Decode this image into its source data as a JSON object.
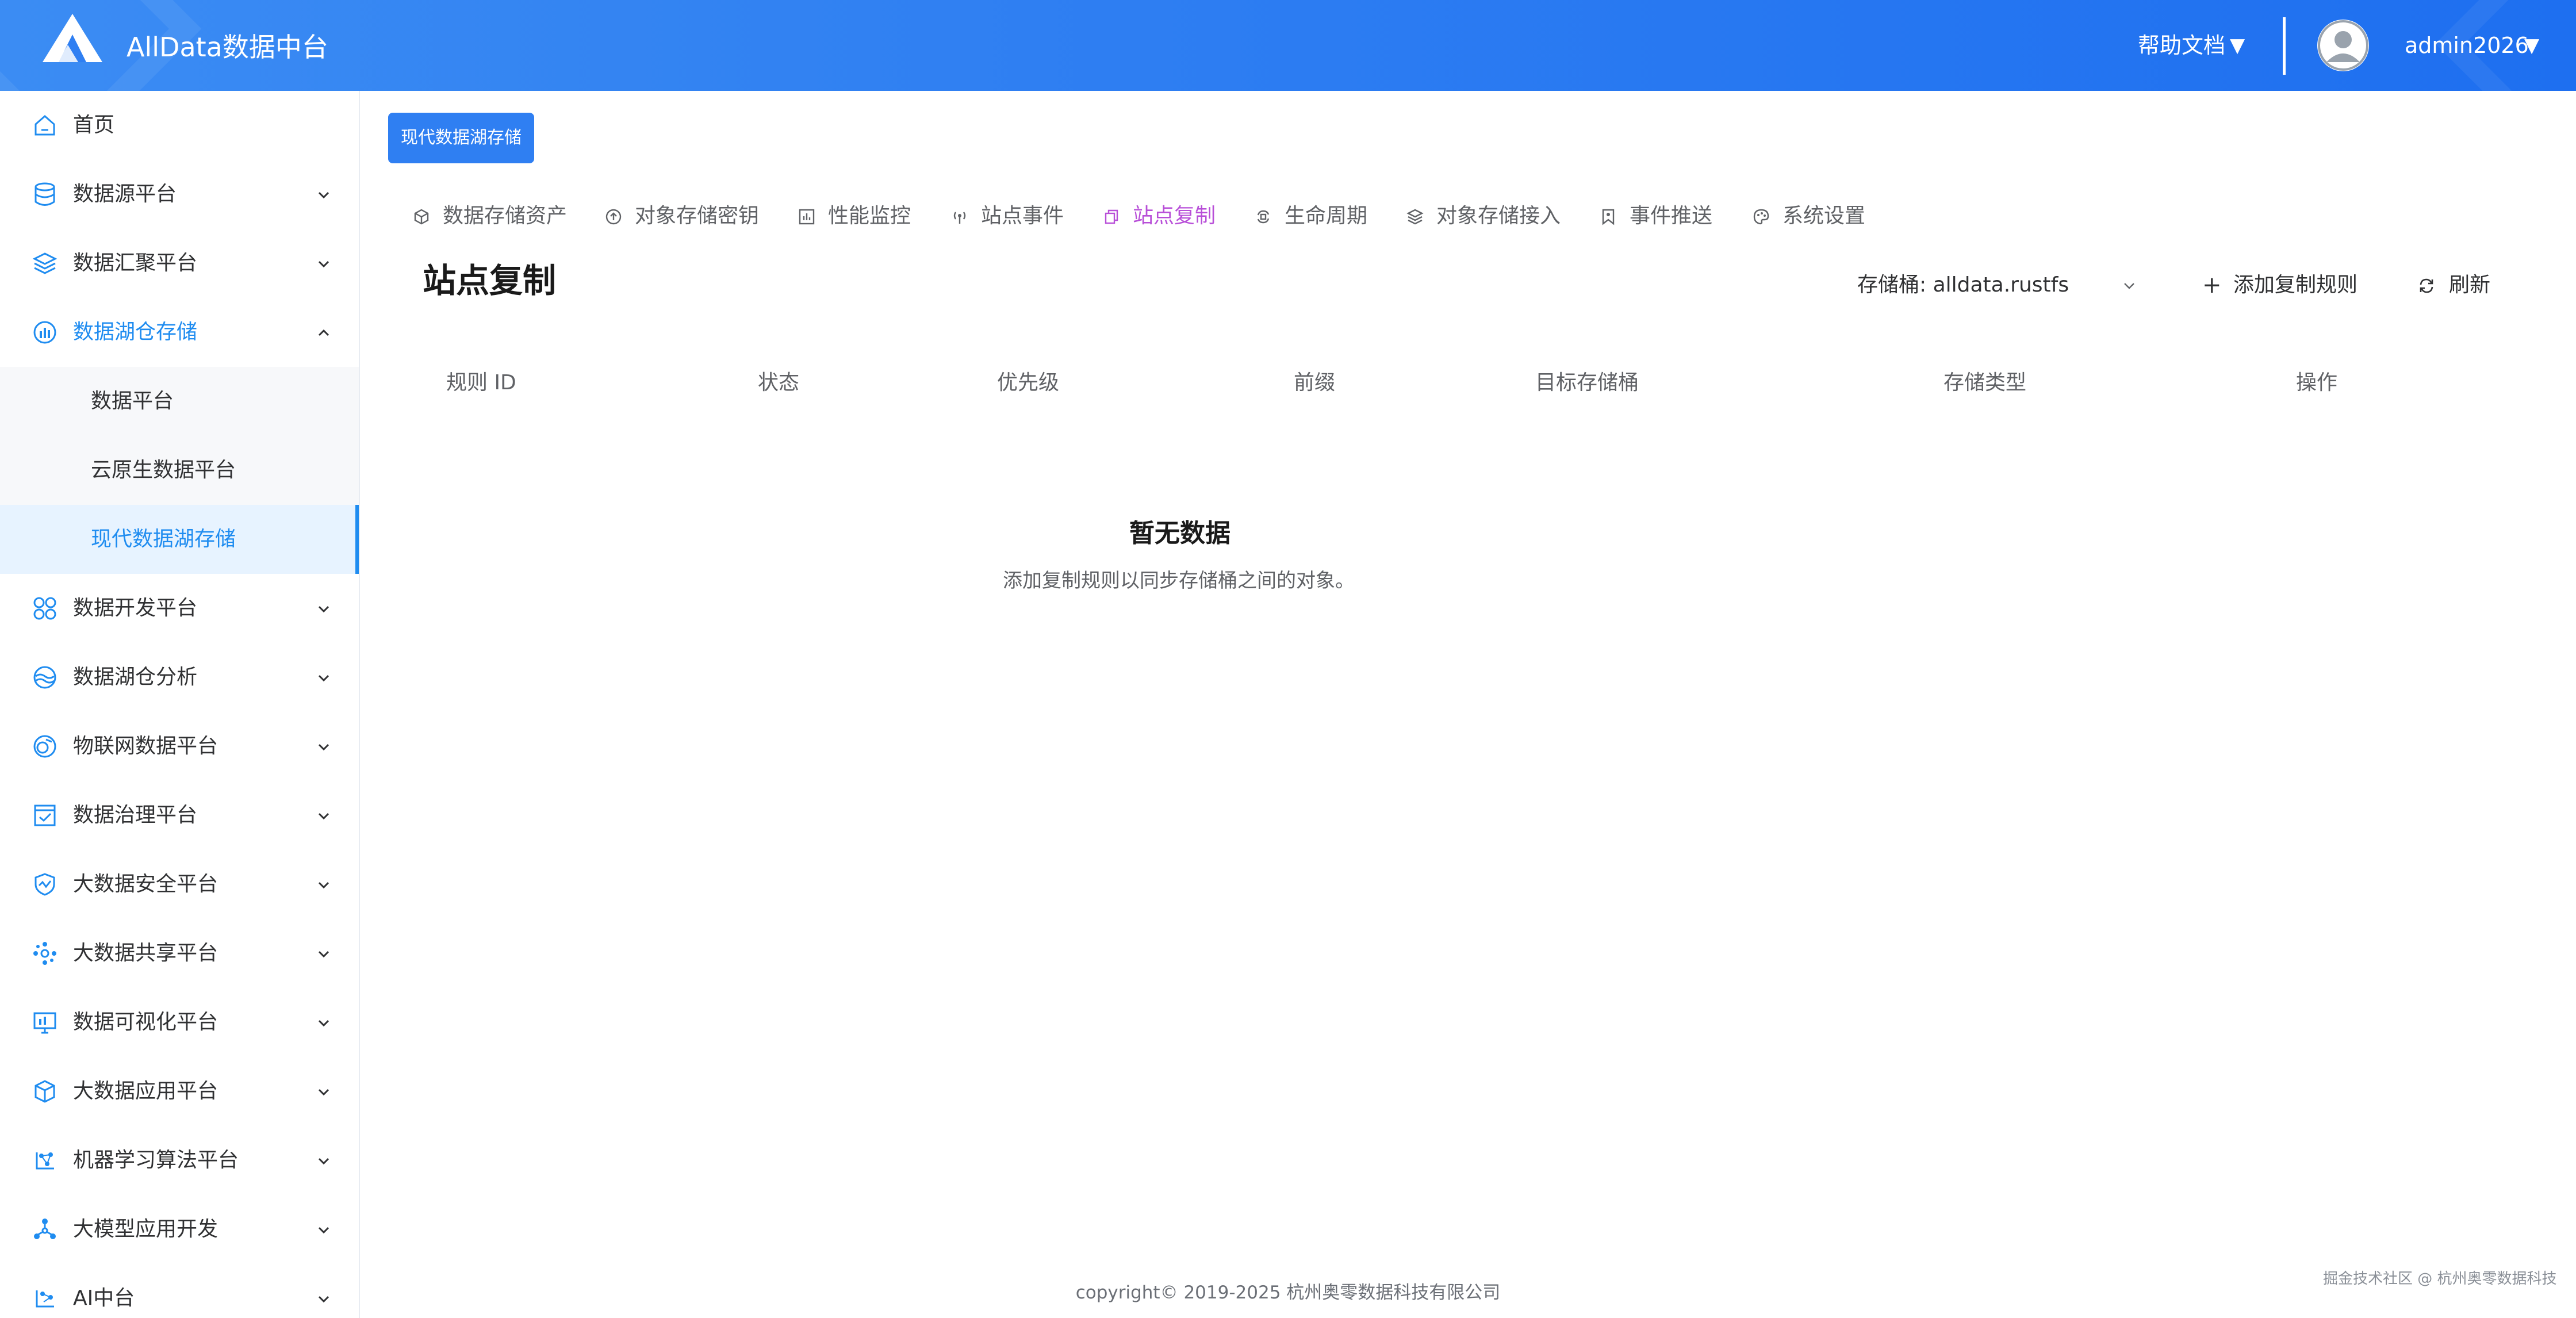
{
  "header": {
    "title": "AllData数据中台",
    "help": "帮助文档",
    "caret": "▼",
    "user": "admin2026"
  },
  "sidebar": {
    "items": [
      {
        "label": "首页",
        "icon": "home-icon"
      },
      {
        "label": "数据源平台",
        "icon": "database-icon"
      },
      {
        "label": "数据汇聚平台",
        "icon": "layers-icon"
      },
      {
        "label": "数据湖仓存储",
        "icon": "lakehouse-icon"
      },
      {
        "label": "数据开发平台",
        "icon": "apps-icon"
      },
      {
        "label": "数据湖仓分析",
        "icon": "analysis-icon"
      },
      {
        "label": "物联网数据平台",
        "icon": "iot-icon"
      },
      {
        "label": "数据治理平台",
        "icon": "governance-icon"
      },
      {
        "label": "大数据安全平台",
        "icon": "shield-icon"
      },
      {
        "label": "大数据共享平台",
        "icon": "share-icon"
      },
      {
        "label": "数据可视化平台",
        "icon": "monitor-icon"
      },
      {
        "label": "大数据应用平台",
        "icon": "cube-icon"
      },
      {
        "label": "机器学习算法平台",
        "icon": "ml-icon"
      },
      {
        "label": "大模型应用开发",
        "icon": "llm-icon"
      },
      {
        "label": "AI中台",
        "icon": "ai-icon"
      }
    ],
    "subitems": [
      {
        "label": "数据平台"
      },
      {
        "label": "云原生数据平台"
      },
      {
        "label": "现代数据湖存储"
      }
    ]
  },
  "breadcrumb": {
    "label": "现代数据湖存储"
  },
  "tabs": [
    {
      "label": "数据存储资产",
      "icon": "box-icon"
    },
    {
      "label": "对象存储密钥",
      "icon": "key-circle-icon"
    },
    {
      "label": "性能监控",
      "icon": "bar-chart-icon"
    },
    {
      "label": "站点事件",
      "icon": "signal-icon"
    },
    {
      "label": "站点复制",
      "icon": "copy-icon"
    },
    {
      "label": "生命周期",
      "icon": "cycle-icon"
    },
    {
      "label": "对象存储接入",
      "icon": "stack-icon"
    },
    {
      "label": "事件推送",
      "icon": "bookmark-icon"
    },
    {
      "label": "系统设置",
      "icon": "palette-icon"
    }
  ],
  "page": {
    "title": "站点复制",
    "bucket_select": "存储桶: alldata.rustfs",
    "add_rule": "添加复制规则",
    "add_symbol": "+",
    "refresh": "刷新"
  },
  "table": {
    "headers": [
      "规则 ID",
      "状态",
      "优先级",
      "前缀",
      "目标存储桶",
      "存储类型",
      "操作"
    ],
    "empty_title": "暂无数据",
    "empty_desc": "添加复制规则以同步存储桶之间的对象。"
  },
  "footer": {
    "copyright": "copyright© 2019-2025 杭州奥零数据科技有限公司",
    "watermark": "掘金技术社区 @ 杭州奥零数据科技"
  },
  "colors": {
    "header": "#2f7ff2",
    "accent": "#1f8cf0",
    "active_tab": "#b84fd8"
  }
}
